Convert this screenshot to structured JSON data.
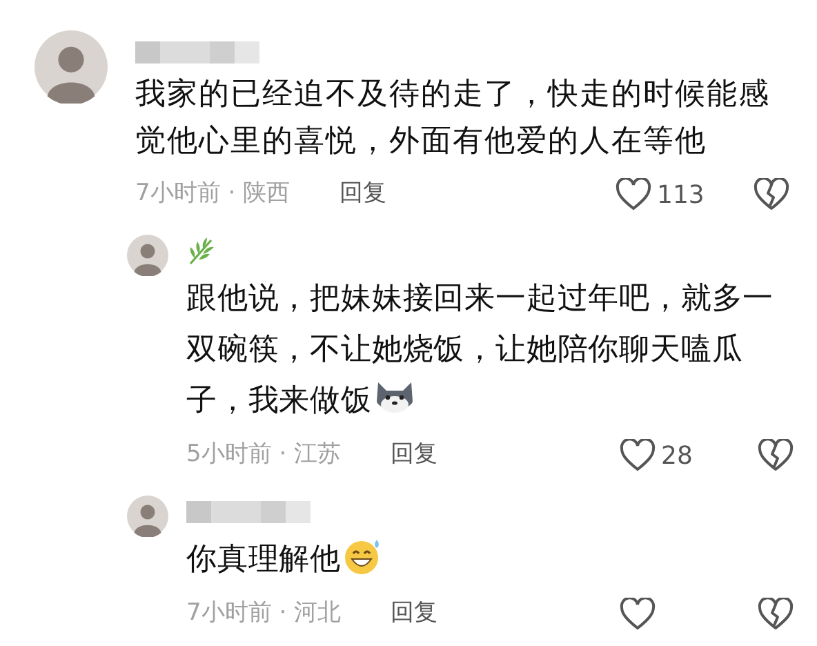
{
  "comments": [
    {
      "kind": "top",
      "badge": false,
      "text": "我家的已经迫不及待的走了，快走的时候能感觉他心里的喜悦，外面有他爱的人在等他",
      "time": "7小时前 · 陕西",
      "reply": "回复",
      "likes": "113"
    },
    {
      "kind": "reply",
      "badge": true,
      "text": "跟他说，把妹妹接回来一起过年吧，就多一双碗筷，不让她烧饭，让她陪你聊天嗑瓜子，我来做饭",
      "emoji": {
        "kind": "husky"
      },
      "time": "5小时前 · 江苏",
      "reply": "回复",
      "likes": "28"
    },
    {
      "kind": "reply",
      "badge": false,
      "text": "你真理解他",
      "emoji": {
        "kind": "grin"
      },
      "time": "7小时前 · 河北",
      "reply": "回复"
    }
  ]
}
